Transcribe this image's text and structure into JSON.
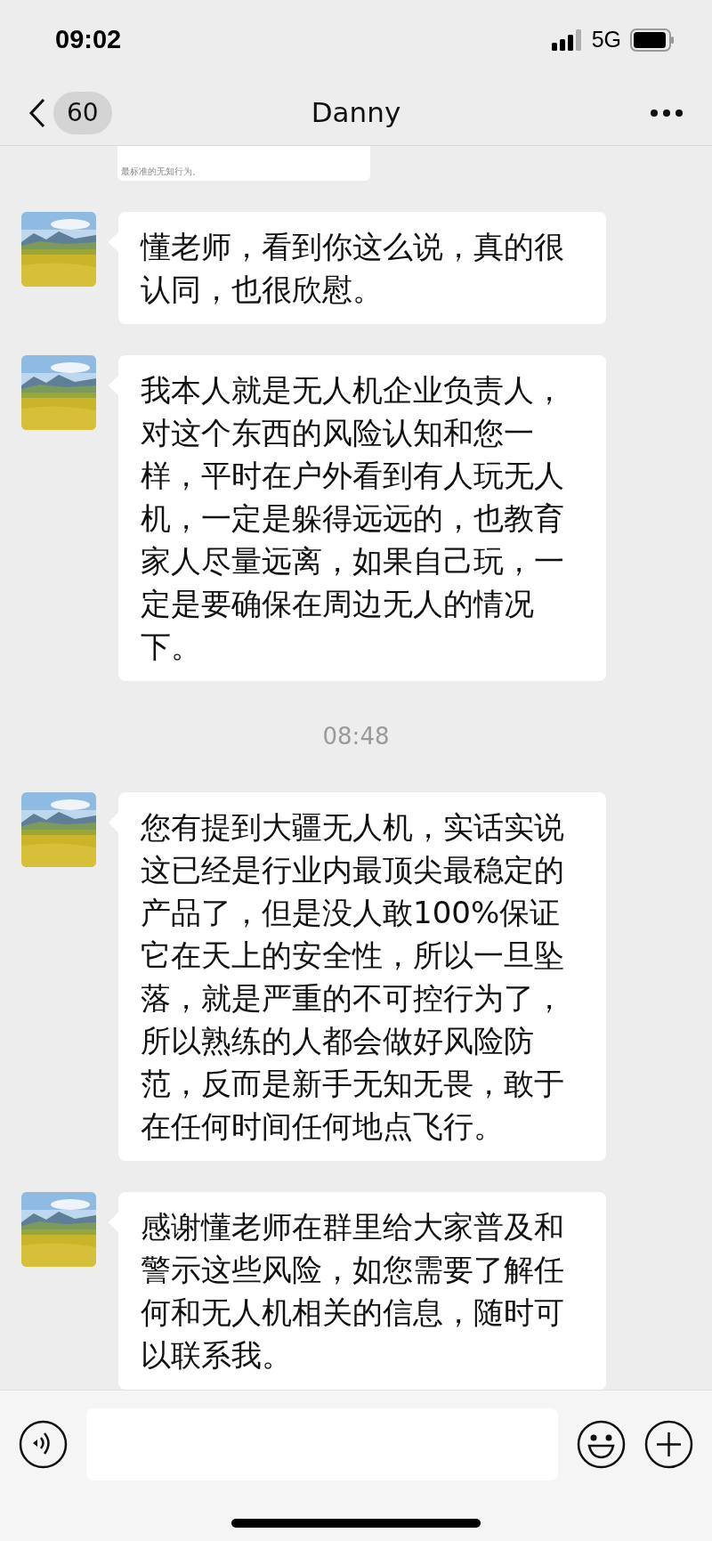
{
  "status_bar": {
    "time": "09:02",
    "network": "5G"
  },
  "header": {
    "unread_count": "60",
    "title": "Danny"
  },
  "quoted_card": {
    "text": "最标准的无知行为。"
  },
  "messages": [
    {
      "kind": "message",
      "text": "懂老师，看到你这么说，真的很认同，也很欣慰。"
    },
    {
      "kind": "message",
      "text": "我本人就是无人机企业负责人，对这个东西的风险认知和您一样，平时在户外看到有人玩无人机，一定是躲得远远的，也教育家人尽量远离，如果自己玩，一定是要确保在周边无人的情况下。"
    },
    {
      "kind": "time",
      "text": "08:48"
    },
    {
      "kind": "message",
      "text": "您有提到大疆无人机，实话实说这已经是行业内最顶尖最稳定的产品了，但是没人敢100%保证它在天上的安全性，所以一旦坠落，就是严重的不可控行为了，所以熟练的人都会做好风险防范，反而是新手无知无畏，敢于在任何时间任何地点飞行。"
    },
    {
      "kind": "message",
      "text": "感谢懂老师在群里给大家普及和警示这些风险，如您需要了解任何和无人机相关的信息，随时可以联系我。"
    }
  ]
}
